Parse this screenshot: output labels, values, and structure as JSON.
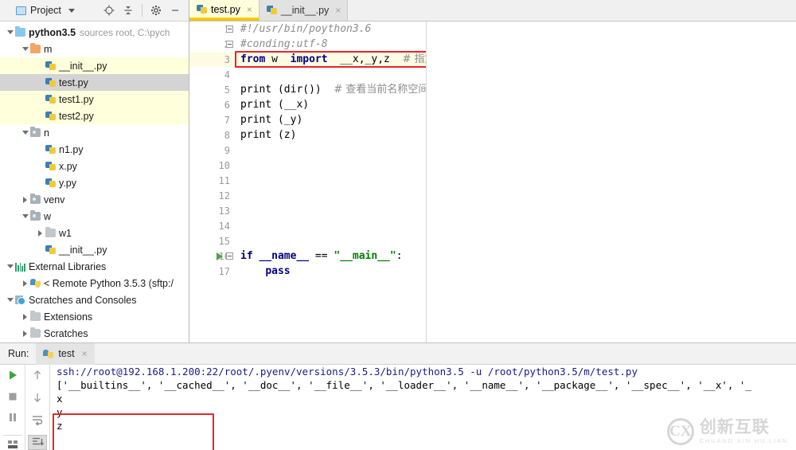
{
  "window": {
    "project_panel": {
      "title": "Project",
      "title_icon": "project-icon",
      "dropdown_icon": "chevron-down-icon",
      "toolbar_icons": [
        "target-scroll-icon",
        "collapse-all-icon",
        "settings-gear-icon",
        "minimize-icon"
      ]
    },
    "tree": [
      {
        "indent": 0,
        "arrow": "down",
        "icon": "folder-blue",
        "label": "python3.5",
        "sub": "sources root, C:\\pych",
        "bold": true,
        "state": "normal"
      },
      {
        "indent": 1,
        "arrow": "down",
        "icon": "folder-orange",
        "label": "m",
        "sub": "",
        "bold": false,
        "state": "normal"
      },
      {
        "indent": 2,
        "arrow": "none",
        "icon": "python-file",
        "label": "__init__.py",
        "sub": "",
        "bold": false,
        "state": "highlight"
      },
      {
        "indent": 2,
        "arrow": "none",
        "icon": "python-file",
        "label": "test.py",
        "sub": "",
        "bold": false,
        "state": "selected"
      },
      {
        "indent": 2,
        "arrow": "none",
        "icon": "python-file",
        "label": "test1.py",
        "sub": "",
        "bold": false,
        "state": "highlight"
      },
      {
        "indent": 2,
        "arrow": "none",
        "icon": "python-file",
        "label": "test2.py",
        "sub": "",
        "bold": false,
        "state": "highlight"
      },
      {
        "indent": 1,
        "arrow": "down",
        "icon": "folder-gray",
        "label": "n",
        "sub": "",
        "bold": false,
        "state": "normal"
      },
      {
        "indent": 2,
        "arrow": "none",
        "icon": "python-file",
        "label": "n1.py",
        "sub": "",
        "bold": false,
        "state": "normal"
      },
      {
        "indent": 2,
        "arrow": "none",
        "icon": "python-file",
        "label": "x.py",
        "sub": "",
        "bold": false,
        "state": "normal"
      },
      {
        "indent": 2,
        "arrow": "none",
        "icon": "python-file",
        "label": "y.py",
        "sub": "",
        "bold": false,
        "state": "normal"
      },
      {
        "indent": 1,
        "arrow": "right",
        "icon": "folder-gray",
        "label": "venv",
        "sub": "",
        "bold": false,
        "state": "normal"
      },
      {
        "indent": 1,
        "arrow": "down",
        "icon": "folder-gray",
        "label": "w",
        "sub": "",
        "bold": false,
        "state": "normal"
      },
      {
        "indent": 2,
        "arrow": "right",
        "icon": "folder-plain",
        "label": "w1",
        "sub": "",
        "bold": false,
        "state": "normal"
      },
      {
        "indent": 2,
        "arrow": "none",
        "icon": "python-file",
        "label": "__init__.py",
        "sub": "",
        "bold": false,
        "state": "normal"
      },
      {
        "indent": 0,
        "arrow": "down",
        "icon": "external-libraries",
        "label": "External Libraries",
        "sub": "",
        "bold": false,
        "state": "normal"
      },
      {
        "indent": 1,
        "arrow": "right",
        "icon": "python-logo",
        "label": "< Remote Python 3.5.3 (sftp:/",
        "sub": "",
        "bold": false,
        "state": "normal"
      },
      {
        "indent": 0,
        "arrow": "down",
        "icon": "scratches-icon",
        "label": "Scratches and Consoles",
        "sub": "",
        "bold": false,
        "state": "normal"
      },
      {
        "indent": 1,
        "arrow": "right",
        "icon": "folder-plain",
        "label": "Extensions",
        "sub": "",
        "bold": false,
        "state": "normal"
      },
      {
        "indent": 1,
        "arrow": "right",
        "icon": "folder-plain",
        "label": "Scratches",
        "sub": "",
        "bold": false,
        "state": "normal"
      }
    ],
    "tabs": [
      {
        "label": "test.py",
        "icon": "python-file",
        "active": true,
        "close": "×"
      },
      {
        "label": "__init__.py",
        "icon": "python-file",
        "active": false,
        "close": "×"
      }
    ],
    "editor": {
      "gutter_numbers": [
        "1",
        "2",
        "3",
        "4",
        "5",
        "6",
        "7",
        "8",
        "9",
        "10",
        "11",
        "12",
        "13",
        "14",
        "15",
        "16",
        "17"
      ],
      "highlighted_line": 3,
      "run_marker_line": 16,
      "lines": [
        {
          "n": 1,
          "tokens": [
            {
              "t": "comment",
              "v": "#!/usr/bin/poython3.6"
            }
          ]
        },
        {
          "n": 2,
          "tokens": [
            {
              "t": "comment",
              "v": "#conding:utf-8"
            }
          ]
        },
        {
          "n": 3,
          "tokens": [
            {
              "t": "kw",
              "v": "from"
            },
            {
              "t": "plain",
              "v": " w  "
            },
            {
              "t": "kw",
              "v": "import"
            },
            {
              "t": "plain",
              "v": "  __x,_y,z  "
            },
            {
              "t": "comment-cn",
              "v": "# 指定其中的方法或类及变量名"
            }
          ]
        },
        {
          "n": 4,
          "tokens": []
        },
        {
          "n": 5,
          "tokens": [
            {
              "t": "plain",
              "v": "print (dir())  "
            },
            {
              "t": "comment-cn",
              "v": "# 查看当前名称空间变量值"
            }
          ]
        },
        {
          "n": 6,
          "tokens": [
            {
              "t": "plain",
              "v": "print (__x)"
            }
          ]
        },
        {
          "n": 7,
          "tokens": [
            {
              "t": "plain",
              "v": "print (_y)"
            }
          ]
        },
        {
          "n": 8,
          "tokens": [
            {
              "t": "plain",
              "v": "print (z)"
            }
          ]
        },
        {
          "n": 9,
          "tokens": []
        },
        {
          "n": 10,
          "tokens": []
        },
        {
          "n": 11,
          "tokens": []
        },
        {
          "n": 12,
          "tokens": []
        },
        {
          "n": 13,
          "tokens": []
        },
        {
          "n": 14,
          "tokens": []
        },
        {
          "n": 15,
          "tokens": []
        },
        {
          "n": 16,
          "tokens": [
            {
              "t": "kw",
              "v": "if"
            },
            {
              "t": "plain",
              "v": " "
            },
            {
              "t": "dunder",
              "v": "__name__"
            },
            {
              "t": "plain",
              "v": " == "
            },
            {
              "t": "str",
              "v": "\"__main__\""
            },
            {
              "t": "plain",
              "v": ":"
            }
          ]
        },
        {
          "n": 17,
          "tokens": [
            {
              "t": "plain",
              "v": "    "
            },
            {
              "t": "kw",
              "v": "pass"
            }
          ]
        }
      ]
    },
    "run_panel": {
      "label": "Run:",
      "tab": {
        "label": "test",
        "icon": "python-logo",
        "close": "×"
      },
      "sidebar_icons": [
        "run-icon",
        "stop-icon",
        "pause-icon",
        "print-icon",
        "up-arrow-icon",
        "down-arrow-icon",
        "soft-wrap-icon",
        "scroll-to-end-icon"
      ],
      "console": [
        {
          "type": "cmd",
          "text": "ssh://root@192.168.1.200:22/root/.pyenv/versions/3.5.3/bin/python3.5 -u /root/python3.5/m/test.py"
        },
        {
          "type": "out",
          "text": "['__builtins__', '__cached__', '__doc__', '__file__', '__loader__', '__name__', '__package__', '__spec__', '__x', '_"
        },
        {
          "type": "out",
          "text": "x"
        },
        {
          "type": "out",
          "text": "y"
        },
        {
          "type": "out",
          "text": "z"
        }
      ]
    },
    "annotations": {
      "highlight_color": "#e8242a",
      "boxes": [
        {
          "name": "import-line-highlight-box"
        },
        {
          "name": "console-output-highlight-box"
        }
      ]
    },
    "watermark": {
      "mark": "CX",
      "chinese": "创新互联",
      "pinyin": "CHUANG XIN HU LIAN"
    }
  }
}
